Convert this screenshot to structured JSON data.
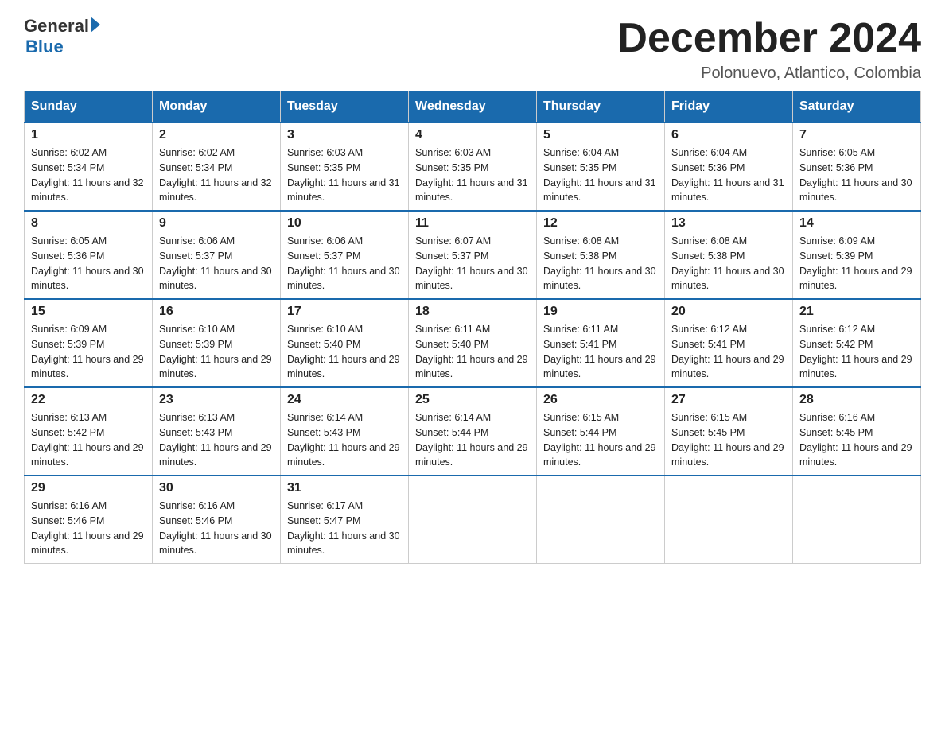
{
  "logo": {
    "general": "General",
    "blue": "Blue"
  },
  "title": "December 2024",
  "subtitle": "Polonuevo, Atlantico, Colombia",
  "headers": [
    "Sunday",
    "Monday",
    "Tuesday",
    "Wednesday",
    "Thursday",
    "Friday",
    "Saturday"
  ],
  "weeks": [
    [
      {
        "day": "1",
        "sunrise": "Sunrise: 6:02 AM",
        "sunset": "Sunset: 5:34 PM",
        "daylight": "Daylight: 11 hours and 32 minutes."
      },
      {
        "day": "2",
        "sunrise": "Sunrise: 6:02 AM",
        "sunset": "Sunset: 5:34 PM",
        "daylight": "Daylight: 11 hours and 32 minutes."
      },
      {
        "day": "3",
        "sunrise": "Sunrise: 6:03 AM",
        "sunset": "Sunset: 5:35 PM",
        "daylight": "Daylight: 11 hours and 31 minutes."
      },
      {
        "day": "4",
        "sunrise": "Sunrise: 6:03 AM",
        "sunset": "Sunset: 5:35 PM",
        "daylight": "Daylight: 11 hours and 31 minutes."
      },
      {
        "day": "5",
        "sunrise": "Sunrise: 6:04 AM",
        "sunset": "Sunset: 5:35 PM",
        "daylight": "Daylight: 11 hours and 31 minutes."
      },
      {
        "day": "6",
        "sunrise": "Sunrise: 6:04 AM",
        "sunset": "Sunset: 5:36 PM",
        "daylight": "Daylight: 11 hours and 31 minutes."
      },
      {
        "day": "7",
        "sunrise": "Sunrise: 6:05 AM",
        "sunset": "Sunset: 5:36 PM",
        "daylight": "Daylight: 11 hours and 30 minutes."
      }
    ],
    [
      {
        "day": "8",
        "sunrise": "Sunrise: 6:05 AM",
        "sunset": "Sunset: 5:36 PM",
        "daylight": "Daylight: 11 hours and 30 minutes."
      },
      {
        "day": "9",
        "sunrise": "Sunrise: 6:06 AM",
        "sunset": "Sunset: 5:37 PM",
        "daylight": "Daylight: 11 hours and 30 minutes."
      },
      {
        "day": "10",
        "sunrise": "Sunrise: 6:06 AM",
        "sunset": "Sunset: 5:37 PM",
        "daylight": "Daylight: 11 hours and 30 minutes."
      },
      {
        "day": "11",
        "sunrise": "Sunrise: 6:07 AM",
        "sunset": "Sunset: 5:37 PM",
        "daylight": "Daylight: 11 hours and 30 minutes."
      },
      {
        "day": "12",
        "sunrise": "Sunrise: 6:08 AM",
        "sunset": "Sunset: 5:38 PM",
        "daylight": "Daylight: 11 hours and 30 minutes."
      },
      {
        "day": "13",
        "sunrise": "Sunrise: 6:08 AM",
        "sunset": "Sunset: 5:38 PM",
        "daylight": "Daylight: 11 hours and 30 minutes."
      },
      {
        "day": "14",
        "sunrise": "Sunrise: 6:09 AM",
        "sunset": "Sunset: 5:39 PM",
        "daylight": "Daylight: 11 hours and 29 minutes."
      }
    ],
    [
      {
        "day": "15",
        "sunrise": "Sunrise: 6:09 AM",
        "sunset": "Sunset: 5:39 PM",
        "daylight": "Daylight: 11 hours and 29 minutes."
      },
      {
        "day": "16",
        "sunrise": "Sunrise: 6:10 AM",
        "sunset": "Sunset: 5:39 PM",
        "daylight": "Daylight: 11 hours and 29 minutes."
      },
      {
        "day": "17",
        "sunrise": "Sunrise: 6:10 AM",
        "sunset": "Sunset: 5:40 PM",
        "daylight": "Daylight: 11 hours and 29 minutes."
      },
      {
        "day": "18",
        "sunrise": "Sunrise: 6:11 AM",
        "sunset": "Sunset: 5:40 PM",
        "daylight": "Daylight: 11 hours and 29 minutes."
      },
      {
        "day": "19",
        "sunrise": "Sunrise: 6:11 AM",
        "sunset": "Sunset: 5:41 PM",
        "daylight": "Daylight: 11 hours and 29 minutes."
      },
      {
        "day": "20",
        "sunrise": "Sunrise: 6:12 AM",
        "sunset": "Sunset: 5:41 PM",
        "daylight": "Daylight: 11 hours and 29 minutes."
      },
      {
        "day": "21",
        "sunrise": "Sunrise: 6:12 AM",
        "sunset": "Sunset: 5:42 PM",
        "daylight": "Daylight: 11 hours and 29 minutes."
      }
    ],
    [
      {
        "day": "22",
        "sunrise": "Sunrise: 6:13 AM",
        "sunset": "Sunset: 5:42 PM",
        "daylight": "Daylight: 11 hours and 29 minutes."
      },
      {
        "day": "23",
        "sunrise": "Sunrise: 6:13 AM",
        "sunset": "Sunset: 5:43 PM",
        "daylight": "Daylight: 11 hours and 29 minutes."
      },
      {
        "day": "24",
        "sunrise": "Sunrise: 6:14 AM",
        "sunset": "Sunset: 5:43 PM",
        "daylight": "Daylight: 11 hours and 29 minutes."
      },
      {
        "day": "25",
        "sunrise": "Sunrise: 6:14 AM",
        "sunset": "Sunset: 5:44 PM",
        "daylight": "Daylight: 11 hours and 29 minutes."
      },
      {
        "day": "26",
        "sunrise": "Sunrise: 6:15 AM",
        "sunset": "Sunset: 5:44 PM",
        "daylight": "Daylight: 11 hours and 29 minutes."
      },
      {
        "day": "27",
        "sunrise": "Sunrise: 6:15 AM",
        "sunset": "Sunset: 5:45 PM",
        "daylight": "Daylight: 11 hours and 29 minutes."
      },
      {
        "day": "28",
        "sunrise": "Sunrise: 6:16 AM",
        "sunset": "Sunset: 5:45 PM",
        "daylight": "Daylight: 11 hours and 29 minutes."
      }
    ],
    [
      {
        "day": "29",
        "sunrise": "Sunrise: 6:16 AM",
        "sunset": "Sunset: 5:46 PM",
        "daylight": "Daylight: 11 hours and 29 minutes."
      },
      {
        "day": "30",
        "sunrise": "Sunrise: 6:16 AM",
        "sunset": "Sunset: 5:46 PM",
        "daylight": "Daylight: 11 hours and 30 minutes."
      },
      {
        "day": "31",
        "sunrise": "Sunrise: 6:17 AM",
        "sunset": "Sunset: 5:47 PM",
        "daylight": "Daylight: 11 hours and 30 minutes."
      },
      null,
      null,
      null,
      null
    ]
  ]
}
